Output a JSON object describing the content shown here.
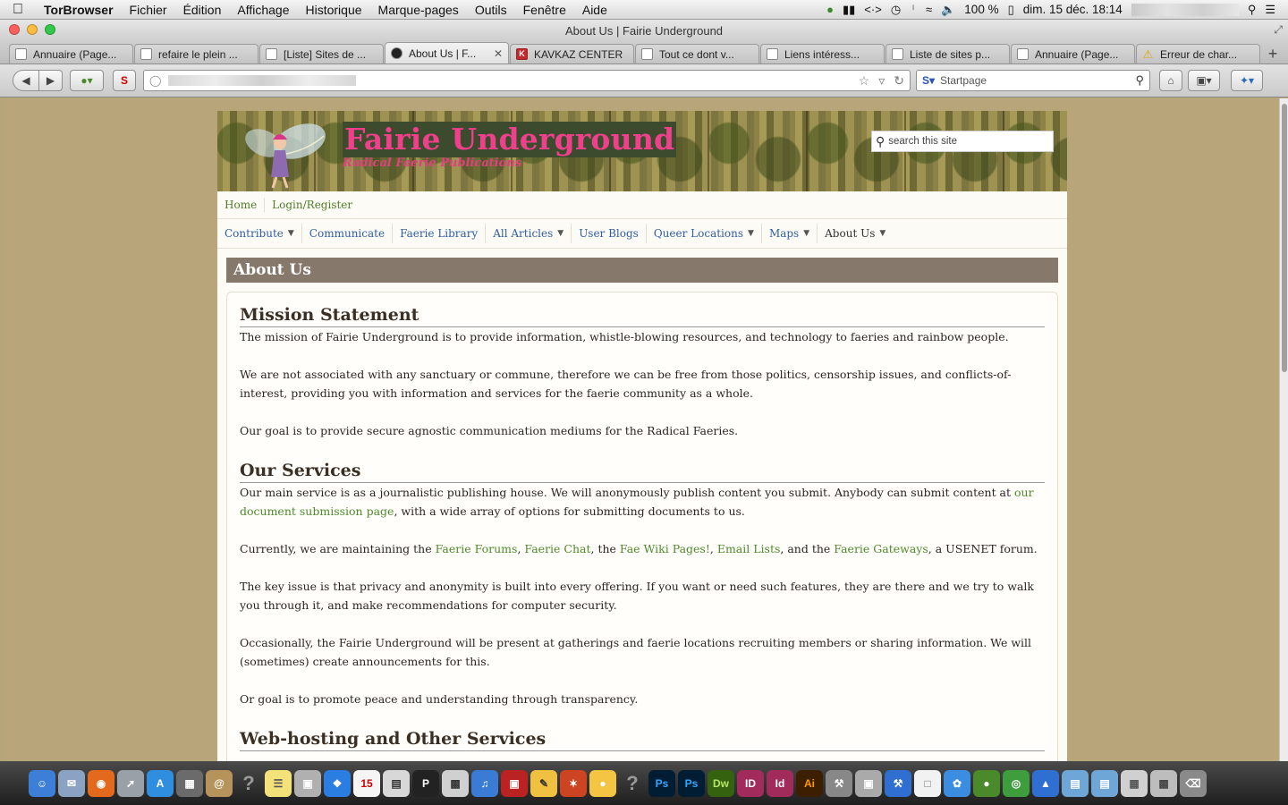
{
  "menubar": {
    "app_name": "TorBrowser",
    "menus": [
      "Fichier",
      "Édition",
      "Affichage",
      "Historique",
      "Marque-pages",
      "Outils",
      "Fenêtre",
      "Aide"
    ],
    "battery": "100 %",
    "clock": "dim. 15 déc.  18:14"
  },
  "window": {
    "title": "About Us | Fairie Underground"
  },
  "tabs": [
    {
      "label": "Annuaire (Page...",
      "active": false
    },
    {
      "label": "refaire le plein ...",
      "active": false
    },
    {
      "label": "[Liste] Sites de ...",
      "active": false
    },
    {
      "label": "About Us | F...",
      "active": true
    },
    {
      "label": "KAVKAZ CENTER",
      "active": false
    },
    {
      "label": "Tout ce dont v...",
      "active": false
    },
    {
      "label": "Liens intéress...",
      "active": false
    },
    {
      "label": "Liste de sites p...",
      "active": false
    },
    {
      "label": "Annuaire (Page...",
      "active": false
    },
    {
      "label": "Erreur de char...",
      "active": false
    }
  ],
  "toolbar": {
    "search_engine": "Startpage",
    "s_button": "S"
  },
  "site": {
    "title": "Fairie Underground",
    "slogan": "Radical Faerie Publications",
    "search_placeholder": "search this site",
    "user_nav": [
      "Home",
      "Login/Register"
    ],
    "main_nav": [
      {
        "label": "Contribute",
        "dropdown": true
      },
      {
        "label": "Communicate",
        "dropdown": false
      },
      {
        "label": "Faerie Library",
        "dropdown": false
      },
      {
        "label": "All Articles",
        "dropdown": true
      },
      {
        "label": "User Blogs",
        "dropdown": false
      },
      {
        "label": "Queer Locations",
        "dropdown": true
      },
      {
        "label": "Maps",
        "dropdown": true
      },
      {
        "label": "About Us",
        "dropdown": true
      }
    ],
    "page_title": "About Us"
  },
  "content": {
    "mission": {
      "heading": "Mission Statement",
      "p1": "The mission of Fairie Underground is to provide information, whistle-blowing resources, and technology to faeries and rainbow people.",
      "p2": "We are not associated with any sanctuary or commune, therefore we can be free from those politics, censorship issues, and conflicts-of-interest, providing you with information and services for the faerie community as a whole.",
      "p3": "Our goal is to provide secure agnostic communication mediums for the Radical Faeries."
    },
    "services": {
      "heading": "Our Services",
      "p1_before": "Our main service is as a journalistic publishing house. We will anonymously publish content you submit. Anybody can submit content at ",
      "p1_link": "our document submission page",
      "p1_after": ", with a wide array of options for submitting documents to us.",
      "p2_a": "Currently, we are maintaining the ",
      "link_forums": "Faerie Forums",
      "p2_b": ", ",
      "link_chat": "Faerie Chat",
      "p2_c": ", the ",
      "link_wiki": "Fae Wiki Pages!",
      "p2_d": ", ",
      "link_email": "Email Lists",
      "p2_e": ", and the ",
      "link_gateways": "Faerie Gateways",
      "p2_f": ", a USENET forum.",
      "p3": "The key issue is that privacy and anonymity is built into every offering. If you want or need such features, they are there and we try to walk you through it, and make recommendations for computer security.",
      "p4": "Occasionally, the Fairie Underground will be present at gatherings and faerie locations recruiting members or sharing information. We will (sometimes) create announcements for this.",
      "p5": "Or goal is to promote peace and understanding through transparency."
    },
    "hosting": {
      "heading": "Web-hosting and Other Services"
    }
  },
  "dock": {
    "labels": [
      "Ps",
      "Ps",
      "Dw",
      "ID",
      "Id",
      "Ai"
    ],
    "calendar_day": "15"
  },
  "colors": {
    "page_bg": "#b8a67a",
    "title_pink": "#f0408c",
    "link_green": "#4e8a2a",
    "nav_blue": "#2e5ea9",
    "header_bar": "#87786c"
  }
}
